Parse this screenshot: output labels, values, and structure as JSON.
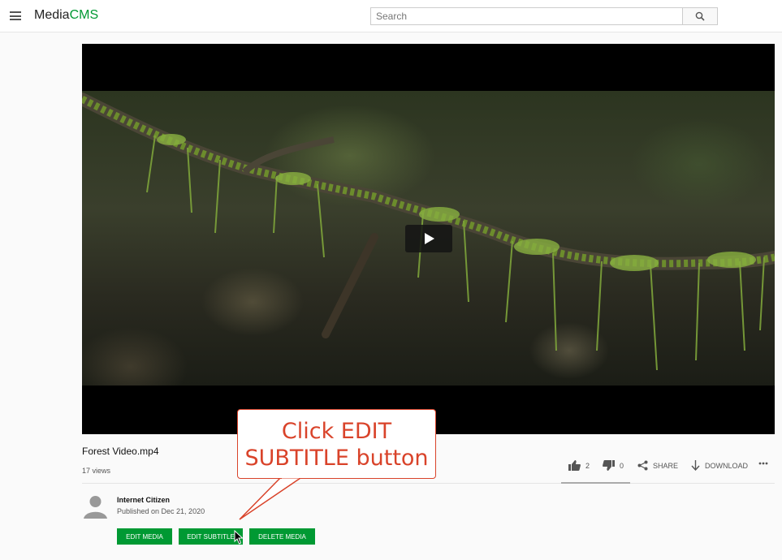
{
  "header": {
    "logo_text": "Media",
    "logo_accent": "CMS",
    "search_placeholder": "Search",
    "menu_icon": "hamburger-icon",
    "search_icon": "search-icon"
  },
  "media": {
    "title": "Forest Video.mp4",
    "views": "17 views",
    "likes": "2",
    "dislikes": "0",
    "share_label": "SHARE",
    "download_label": "DOWNLOAD"
  },
  "author": {
    "name": "Internet Citizen",
    "published": "Published on Dec 21, 2020"
  },
  "buttons": {
    "edit_media": "EDIT MEDIA",
    "edit_subtitle": "EDIT SUBTITLE",
    "delete_media": "DELETE MEDIA"
  },
  "annotation": {
    "line1": "Click EDIT",
    "line2": "SUBTITLE button"
  },
  "colors": {
    "accent": "#009933",
    "callout": "#d9432a"
  }
}
